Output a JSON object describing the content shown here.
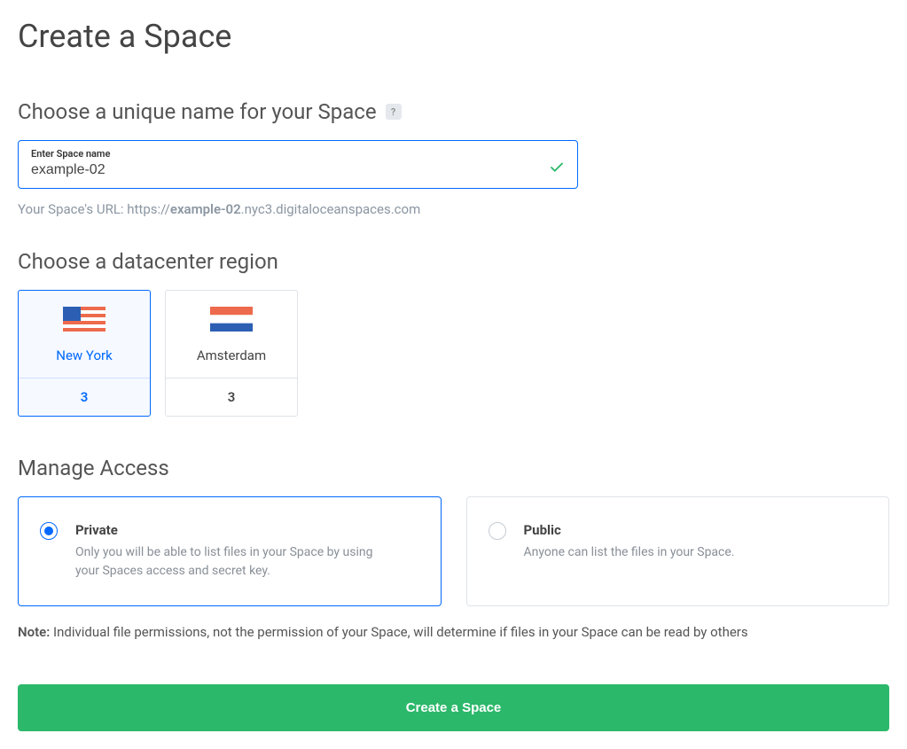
{
  "page": {
    "title": "Create a Space"
  },
  "name_section": {
    "title": "Choose a unique name for your Space",
    "input_label": "Enter Space name",
    "input_value": "example-02",
    "url_prefix": "Your Space's URL: https://",
    "url_host": "example-02",
    "url_suffix": ".nyc3.digitaloceanspaces.com"
  },
  "region_section": {
    "title": "Choose a datacenter region",
    "regions": [
      {
        "name": "New York",
        "code": "3",
        "flag": "us",
        "selected": true
      },
      {
        "name": "Amsterdam",
        "code": "3",
        "flag": "nl",
        "selected": false
      }
    ]
  },
  "access_section": {
    "title": "Manage Access",
    "options": [
      {
        "label": "Private",
        "desc": "Only you will be able to list files in your Space by using your Spaces access and secret key.",
        "selected": true
      },
      {
        "label": "Public",
        "desc": "Anyone can list the files in your Space.",
        "selected": false
      }
    ],
    "note_label": "Note:",
    "note_text": "Individual file permissions, not the permission of your Space, will determine if files in your Space can be read by others"
  },
  "submit": {
    "label": "Create a Space"
  }
}
